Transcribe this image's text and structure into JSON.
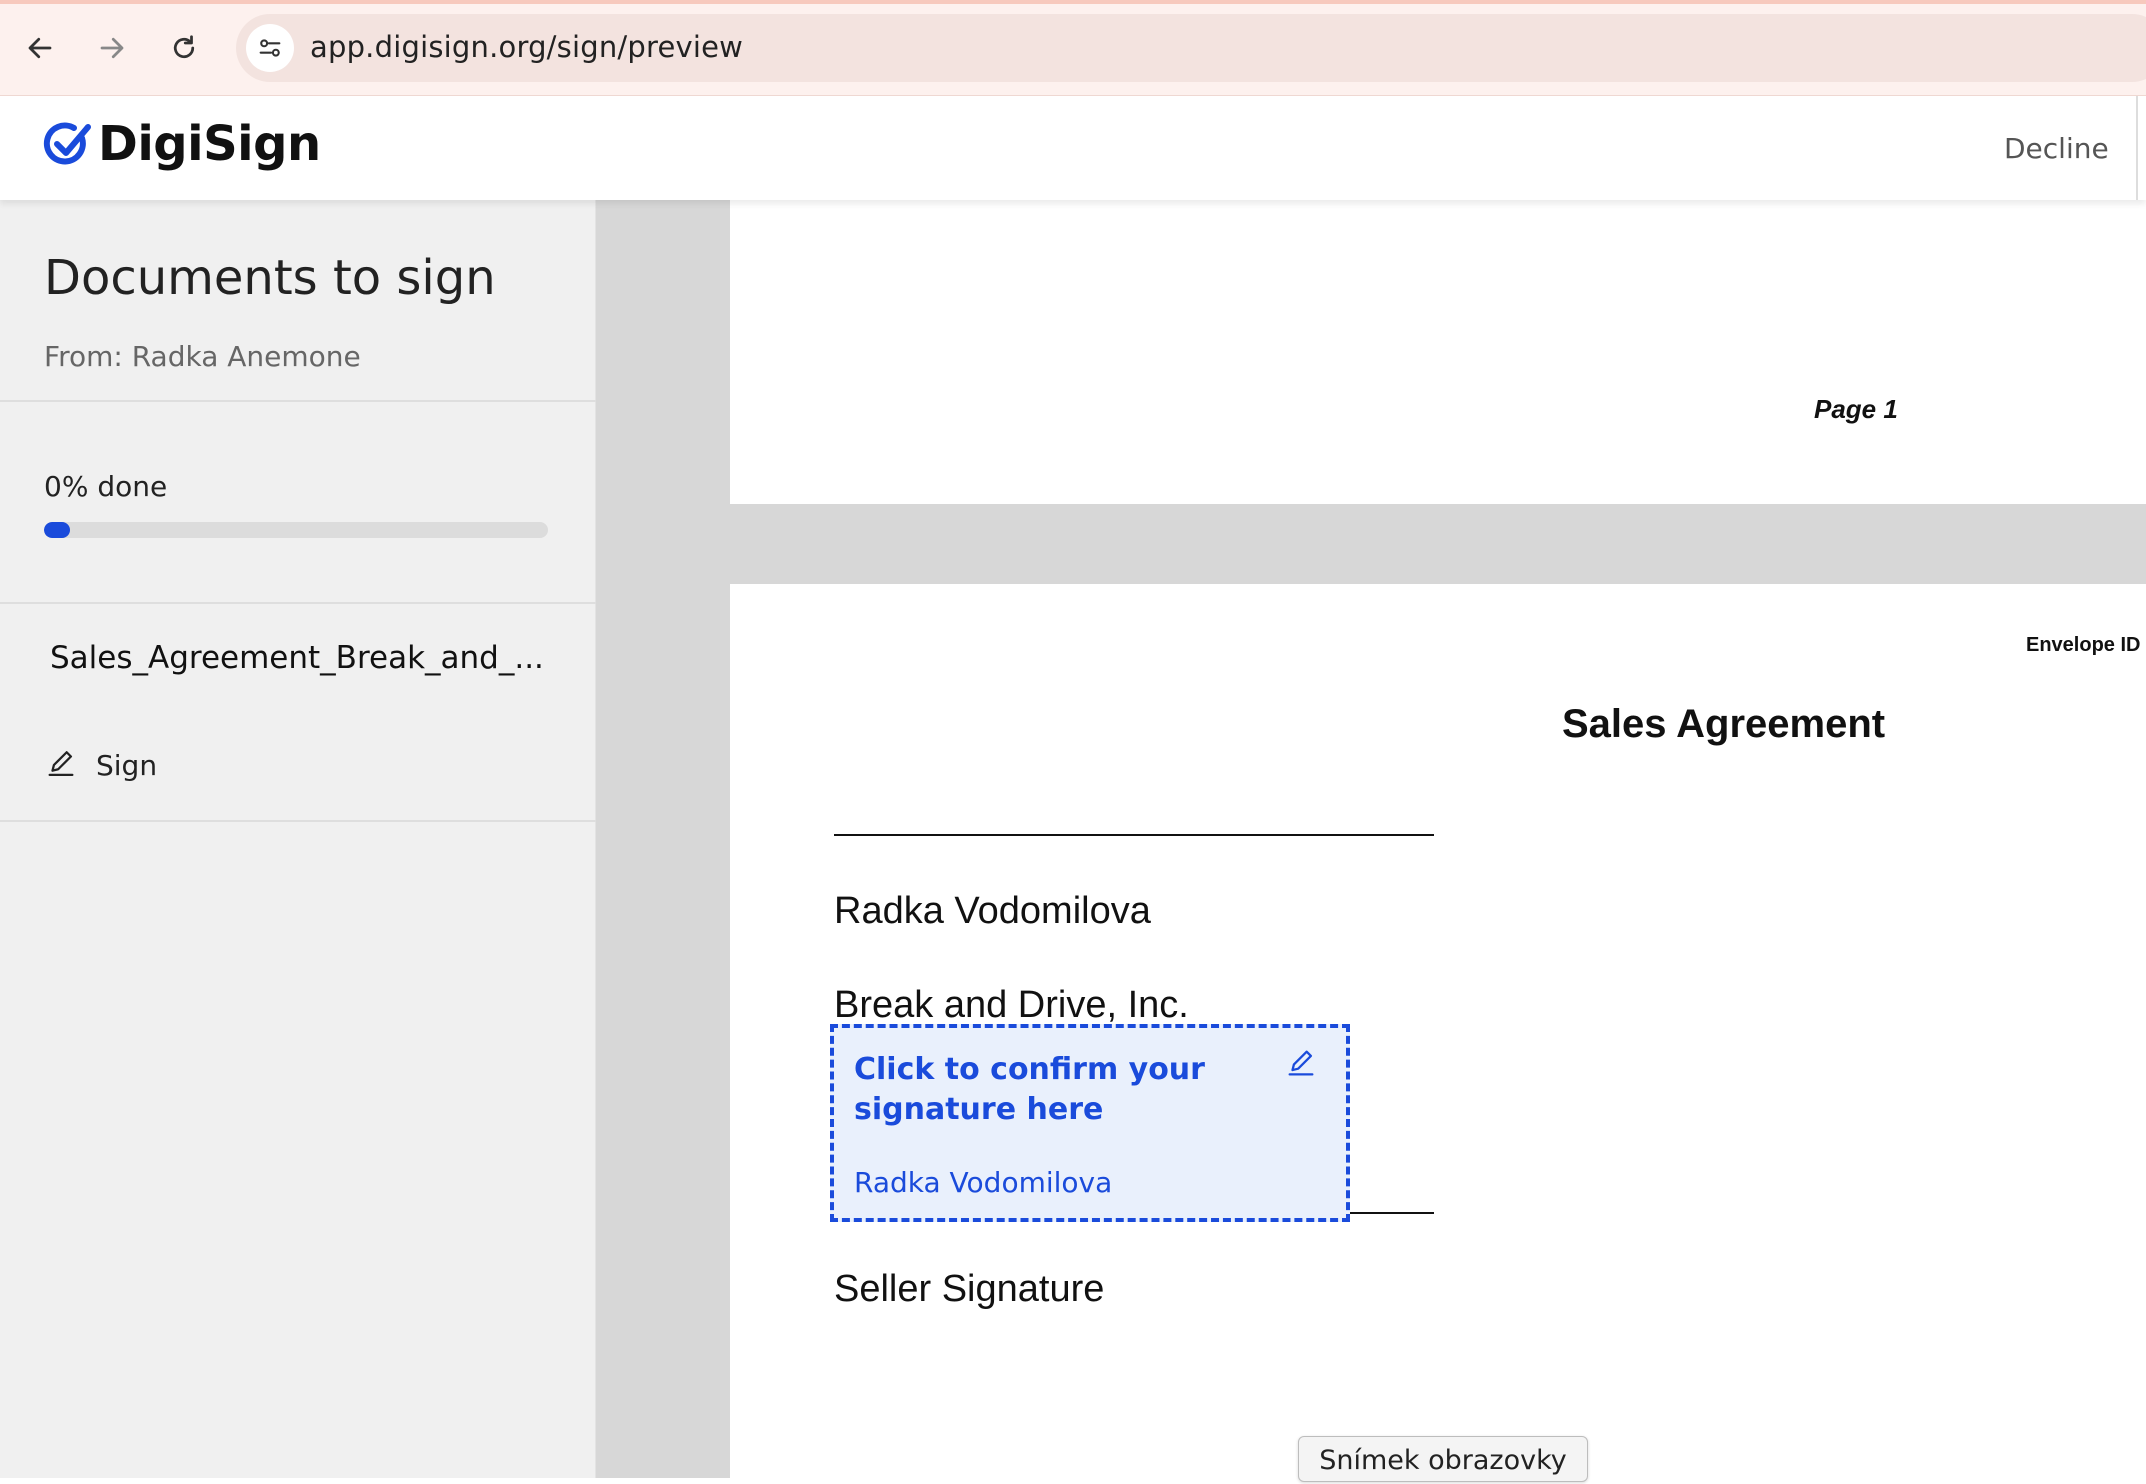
{
  "browser": {
    "url": "app.digisign.org/sign/preview",
    "back_icon": "arrow-left-icon",
    "forward_icon": "arrow-right-icon",
    "reload_icon": "reload-icon",
    "site_info_icon": "tune-icon"
  },
  "header": {
    "logo_text": "DigiSign",
    "decline_label": "Decline"
  },
  "sidebar": {
    "title": "Documents to sign",
    "from": "From: Radka Anemone",
    "progress_label": "0% done",
    "progress_value": 0,
    "document_name": "Sales_Agreement_Break_and_...",
    "sign_label": "Sign"
  },
  "document": {
    "page1_label": "Page 1",
    "envelope_label": "Envelope ID",
    "title": "Sales Agreement",
    "buyer_name": "Radka Vodomilova",
    "company": "Break and Drive, Inc.",
    "seller_signature_label": "Seller Signature",
    "signature_field": {
      "prompt": "Click to confirm your signature here",
      "signer_name": "Radka Vodomilova"
    }
  },
  "tooltip": "Snímek obrazovky",
  "colors": {
    "accent": "#1a4bdb",
    "signature_bg": "#e9f0fc"
  }
}
